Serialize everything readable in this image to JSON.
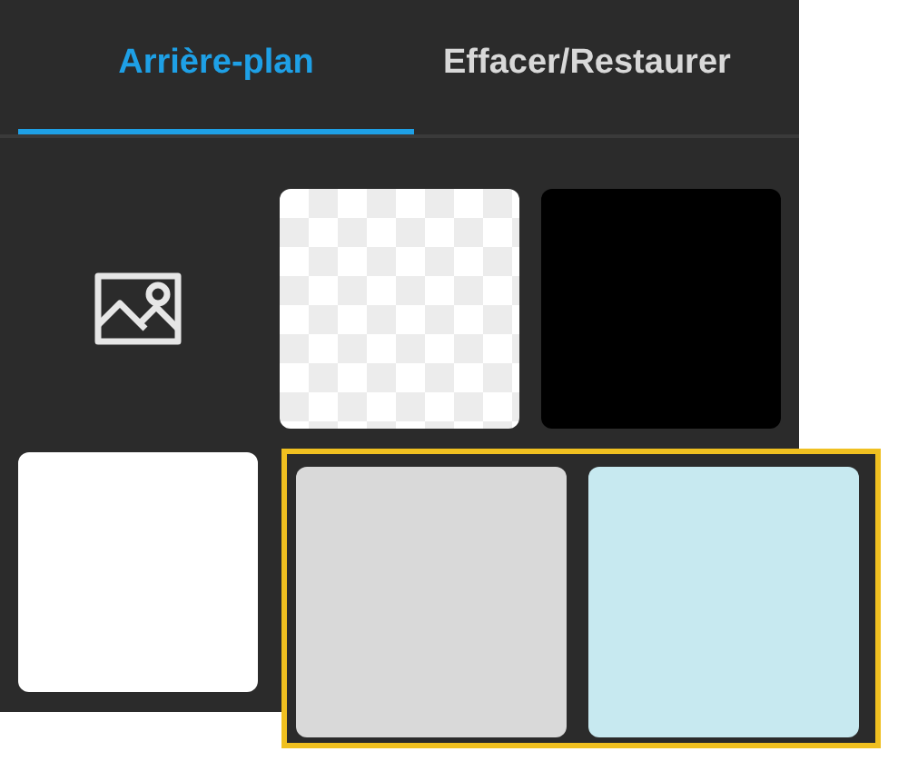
{
  "tabs": [
    {
      "label": "Arrière-plan",
      "selected": true
    },
    {
      "label": "Effacer/Restaurer",
      "selected": false
    }
  ],
  "swatches": [
    {
      "kind": "image"
    },
    {
      "kind": "transparent"
    },
    {
      "kind": "color",
      "color": "#000000"
    },
    {
      "kind": "color",
      "color": "#ffffff"
    }
  ],
  "highlighted_swatches": [
    {
      "kind": "color",
      "color": "#d9d9d9"
    },
    {
      "kind": "color",
      "color": "#c7e9f0"
    }
  ]
}
